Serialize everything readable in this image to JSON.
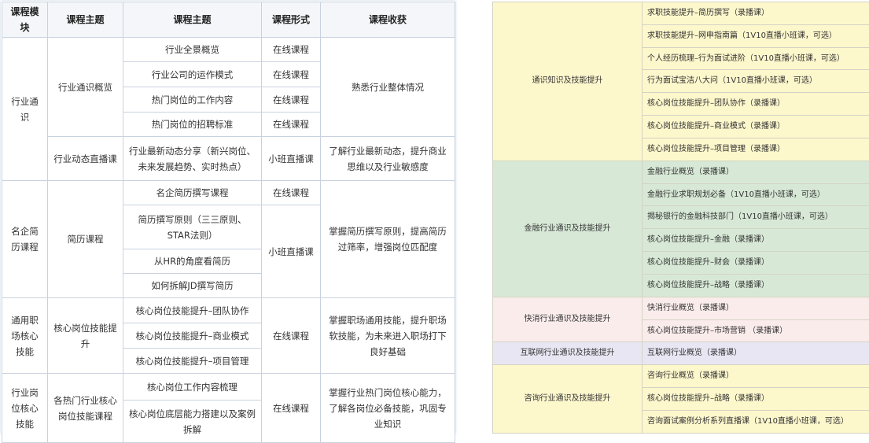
{
  "left_table": {
    "headers": [
      "课程模块",
      "课程主题",
      "课程主题",
      "课程形式",
      "课程收获"
    ],
    "cells": {
      "module_1": "行业通识",
      "topic_1a": "行业通识概览",
      "sub_1": "行业全景概览",
      "sub_2": "行业公司的运作模式",
      "sub_3": "热门岗位的工作内容",
      "sub_4": "热门岗位的招聘标准",
      "form_1": "在线课程",
      "form_2": "在线课程",
      "form_3": "在线课程",
      "form_4": "在线课程",
      "gain_1a": "熟悉行业整体情况",
      "topic_1b": "行业动态直播课",
      "sub_5": "行业最新动态分享（新兴岗位、未来发展趋势、实时热点）",
      "form_5": "小班直播课",
      "gain_1b": "了解行业最新动态，提升商业思维以及行业敏感度",
      "module_2": "名企简历课程",
      "topic_2": "简历课程",
      "sub_6": "名企简历撰写课程",
      "form_6": "在线课程",
      "sub_7": "简历撰写原则（三三原则、STAR法则）",
      "sub_8": "从HR的角度看简历",
      "sub_9": "如何拆解JD撰写简历",
      "form_7": "小班直播课",
      "gain_2": "掌握简历撰写原则，提高简历过筛率，增强岗位匹配度",
      "module_3": "通用职场核心技能",
      "topic_3": "核心岗位技能提升",
      "sub_10": "核心岗位技能提升–团队协作",
      "sub_11": "核心岗位技能提升–商业模式",
      "sub_12": "核心岗位技能提升–项目管理",
      "form_8": "在线课程",
      "gain_3": "掌握职场通用技能，提升职场软技能，为未来进入职场打下良好基础",
      "module_4": "行业岗位核心技能",
      "topic_4": "各热门行业核心岗位技能课程",
      "sub_13": "核心岗位工作内容梳理",
      "sub_14": "核心岗位底层能力搭建以及案例拆解",
      "form_9": "在线课程",
      "gain_4": "掌握行业热门岗位核心能力，了解各岗位必备技能，巩固专业知识"
    }
  },
  "right_table": {
    "groups": [
      {
        "name": "通识知识及技能提升",
        "color": "#fdf7cc",
        "items": [
          "求职技能提升–简历撰写（录播课）",
          "求职技能提升–网申指南篇（1V10直播小班课，可选）",
          "个人经历梳理–行为面试进阶（1V10直播小班课，可选）",
          "行为面试宝洁八大问（1V10直播小班课，可选）",
          "核心岗位技能提升–团队协作（录播课）",
          "核心岗位技能提升–商业模式（录播课）",
          "核心岗位技能提升–项目管理（录播课）"
        ]
      },
      {
        "name": "金融行业通识及技能提升",
        "color": "#d7e9d6",
        "items": [
          "金融行业概览（录播课）",
          "金融行业求职规划必备（1V10直播小班课，可选）",
          "揭秘银行的金融科技部门（1V10直播小班课，可选）",
          "核心岗位技能提升–金融（录播课）",
          "核心岗位技能提升–财会（录播课）",
          "核心岗位技能提升–战略（录播课）"
        ]
      },
      {
        "name": "快消行业通识及技能提升",
        "color": "#fbecec",
        "items": [
          "快消行业概览（录播课）",
          "核心岗位技能提升–市场营销 （录播课）"
        ]
      },
      {
        "name": "互联网行业通识及技能提升",
        "color": "#e9e6f3",
        "items": [
          "互联网行业概览（录播课）"
        ]
      },
      {
        "name": "咨询行业通识及技能提升",
        "color": "#fdf7cc",
        "items": [
          "咨询行业概览（录播课）",
          "核心岗位技能提升–战略（录播课）",
          "咨询面试案例分析系列直播课（1V10直播小班课，可选）"
        ]
      }
    ]
  }
}
